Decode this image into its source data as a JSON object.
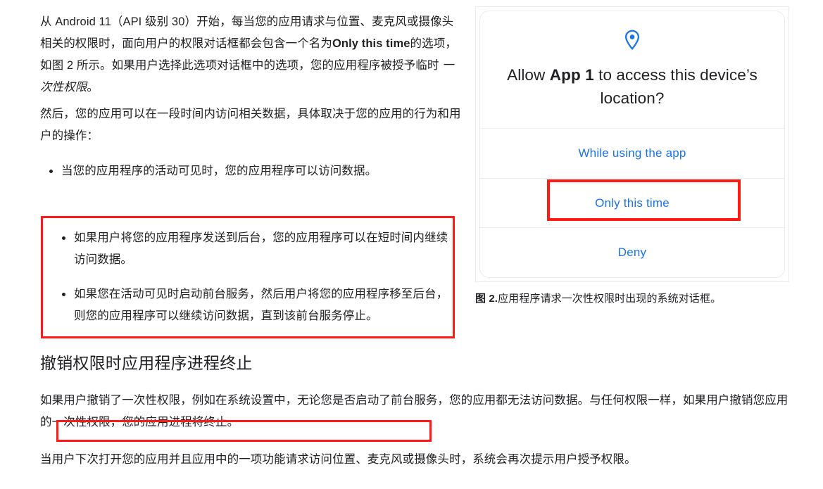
{
  "article": {
    "paragraphs": {
      "p1_part1": "从 Android 11（API 级别 30）开始，每当您的应用请求与位置、麦克风或摄像头相关的权限时，面向用户的权限对话框都会包含一个名为",
      "p1_bold": "Only this time",
      "p1_part2": "的选项，如图 2 所示。如果用户选择此选项对话框中的选项，您的应用程序被授予临时 ",
      "p1_italic": "一次性权限",
      "p1_part3": "。",
      "p2": "然后，您的应用可以在一段时间内访问相关数据，具体取决于您的应用的行为和用户的操作：",
      "p_revoke_part1": "如果用户撤销了一次性权限，例如在系统设置中，无论您是否启动了前台服务，您的应用都无法访问数据。与任何权限一样，",
      "p_revoke_highlight": "如果用户撤销您应用的一次性权限，您的应用进程将终止。",
      "p_final": "当用户下次打开您的应用并且应用中的一项功能请求访问位置、麦克风或摄像头时，系统会再次提示用户授予权限。"
    },
    "bullets_group_1": [
      "当您的应用程序的活动可见时，您的应用程序可以访问数据。"
    ],
    "bullets_group_2": [
      "如果用户将您的应用程序发送到后台，您的应用程序可以在短时间内继续访问数据。",
      "如果您在活动可见时启动前台服务，然后用户将您的应用程序移至后台，则您的应用程序可以继续访问数据，直到该前台服务停止。"
    ],
    "section_heading": "撤销权限时应用程序进程终止"
  },
  "dialog": {
    "icon": "location-pin-icon",
    "title_prefix": "Allow ",
    "title_app": "App 1",
    "title_suffix": " to access this device’s location?",
    "actions": [
      {
        "label": "While using the app",
        "highlighted": false
      },
      {
        "label": "Only this time",
        "highlighted": true
      },
      {
        "label": "Deny",
        "highlighted": false
      }
    ]
  },
  "figure": {
    "number_label": "图 2.",
    "caption_text": "应用程序请求一次性权限时出现的系统对话框。"
  },
  "colors": {
    "annotation_red": "#ff1a15",
    "link_blue": "#1a73e8",
    "text": "#202124",
    "divider": "#eceef0"
  }
}
